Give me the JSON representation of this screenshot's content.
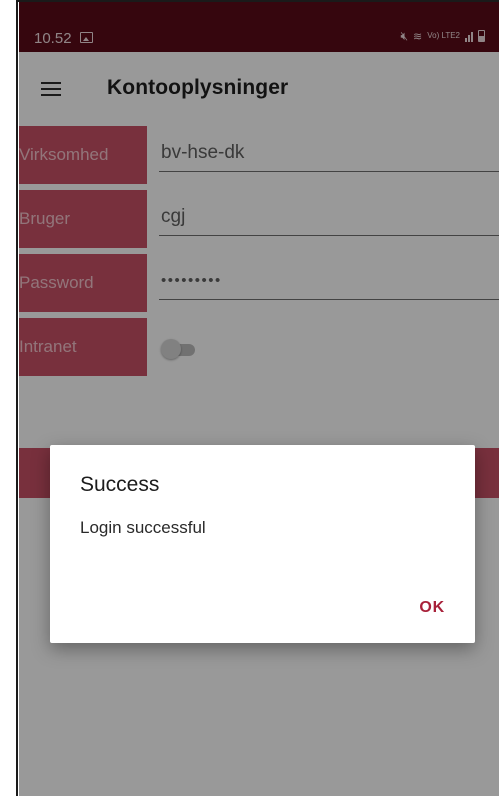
{
  "status_bar": {
    "time": "10.52",
    "icons": [
      "image-icon",
      "mute-icon",
      "wifi-icon",
      "volte-icon",
      "signal-icon",
      "battery-icon"
    ],
    "volte_text": "Vo) LTE2"
  },
  "app_bar": {
    "title": "Kontooplysninger",
    "menu_icon": "menu-icon"
  },
  "form": {
    "company_label": "Virksomhed",
    "company_value": "bv-hse-dk",
    "user_label": "Bruger",
    "user_value": "cgj",
    "password_label": "Password",
    "password_value": "•••••••••",
    "intranet_label": "Intranet",
    "intranet_enabled": false
  },
  "dialog": {
    "title": "Success",
    "message": "Login successful",
    "ok_label": "OK"
  },
  "colors": {
    "status_bar": "#5a0b18",
    "accent": "#c95066",
    "dialog_button": "#a8213a"
  }
}
